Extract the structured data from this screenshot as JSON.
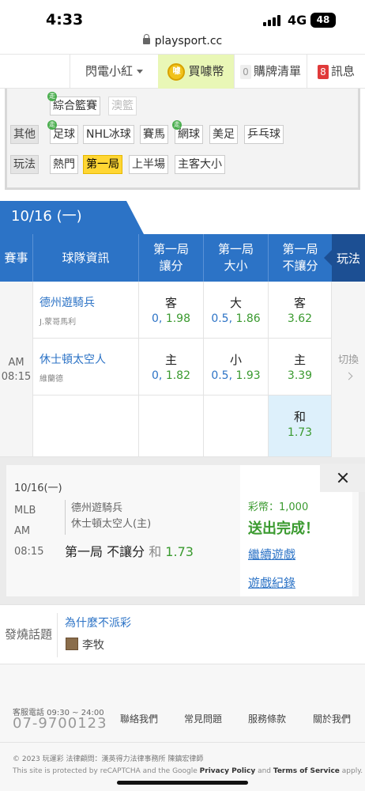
{
  "statusbar": {
    "time": "4:33",
    "network": "4G",
    "battery": "48"
  },
  "browser": {
    "url": "playsport.cc"
  },
  "topnav": {
    "user": "閃電小紅",
    "buy_label": "買噱幣",
    "coin_glyph": "噱",
    "cart_count": "0",
    "cart_label": "購牌清單",
    "msg_count": "8",
    "msg_label": "訊息"
  },
  "filter": {
    "row1": [
      "綜合籃賽",
      "澳籃"
    ],
    "row2_label": "其他",
    "row2": [
      "足球",
      "NHL冰球",
      "賽馬",
      "網球",
      "美足",
      "乒乓球"
    ],
    "row3_label": "玩法",
    "row3": [
      "熱門",
      "第一局",
      "上半場",
      "主客大小"
    ],
    "walk_tag": "走"
  },
  "date_tab": "10/16 (一)",
  "table": {
    "headers": {
      "event": "賽事",
      "team_info": "球隊資訊",
      "col1_line1": "第一局",
      "col1_line2": "讓分",
      "col2_line1": "第一局",
      "col2_line2": "大小",
      "col3_line1": "第一局",
      "col3_line2": "不讓分",
      "play": "玩法"
    },
    "time_line1": "AM",
    "time_line2": "08:15",
    "switch_label": "切換",
    "rows": [
      {
        "team": "德州遊騎兵",
        "pitcher": "J.蒙哥馬利",
        "spread_side": "客",
        "spread_line": "0,",
        "spread_odds": "1.98",
        "total_side": "大",
        "total_line": "0.5,",
        "total_odds": "1.86",
        "ml_side": "客",
        "ml_odds": "3.62"
      },
      {
        "team": "休士頓太空人",
        "pitcher": "維蘭德",
        "spread_side": "主",
        "spread_line": "0,",
        "spread_odds": "1.82",
        "total_side": "小",
        "total_line": "0.5,",
        "total_odds": "1.93",
        "ml_side": "主",
        "ml_odds": "3.39"
      }
    ],
    "draw": {
      "side": "和",
      "odds": "1.73"
    }
  },
  "panel": {
    "date": "10/16(一)",
    "league": "MLB",
    "ampm": "AM",
    "time": "08:15",
    "team_away": "德州遊騎兵",
    "team_home": "休士頓太空人(主)",
    "bet_market": "第一局 不讓分",
    "bet_pick": "和",
    "bet_odds": "1.73",
    "coins": "彩幣：1,000",
    "done": "送出完成！",
    "continue": "繼續遊戲",
    "history": "遊戲紀錄"
  },
  "hot_topic": {
    "label": "發燒話題",
    "title": "為什麼不派彩",
    "author": "李牧"
  },
  "footer": {
    "service_label": "客服電話 09:30 ~ 24:00",
    "phone": "07-9700123",
    "links": [
      "聯絡我們",
      "常見問題",
      "服務條款",
      "關於我們"
    ],
    "copyright": "© 2023 玩運彩 法律顧問：漢英得力法律事務所 陳鎮宏律師",
    "recaptcha_pre": "This site is protected by reCAPTCHA and the Google ",
    "privacy": "Privacy Policy",
    "and": " and ",
    "terms": "Terms of Service",
    "apply": " apply."
  },
  "colors": {
    "primary": "#2c73c6",
    "green": "#3a9a2f",
    "highlight": "#ffd633",
    "selected_cell": "#ddf0fb"
  }
}
